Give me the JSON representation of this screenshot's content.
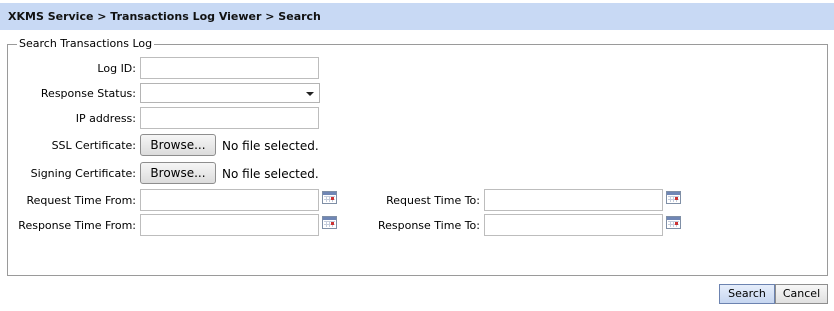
{
  "breadcrumb": "XKMS Service > Transactions Log Viewer > Search",
  "form": {
    "legend": "Search Transactions Log",
    "log_id_label": "Log ID:",
    "log_id_value": "",
    "response_status_label": "Response Status:",
    "response_status_value": "",
    "ip_address_label": "IP address:",
    "ip_address_value": "",
    "ssl_certificate_label": "SSL Certificate:",
    "ssl_browse_label": "Browse...",
    "ssl_file_status": "No file selected.",
    "signing_certificate_label": "Signing Certificate:",
    "signing_browse_label": "Browse...",
    "signing_file_status": "No file selected.",
    "request_time_from_label": "Request Time From:",
    "request_time_from_value": "",
    "request_time_to_label": "Request Time To:",
    "request_time_to_value": "",
    "response_time_from_label": "Response Time From:",
    "response_time_from_value": "",
    "response_time_to_label": "Response Time To:",
    "response_time_to_value": ""
  },
  "actions": {
    "search_label": "Search",
    "cancel_label": "Cancel"
  },
  "icons": {
    "calendar": "calendar-icon",
    "dropdown": "chevron-down-icon"
  },
  "colors": {
    "title_bar_bg": "#c8d9f4",
    "search_button_bg": "#c6d6f0"
  }
}
